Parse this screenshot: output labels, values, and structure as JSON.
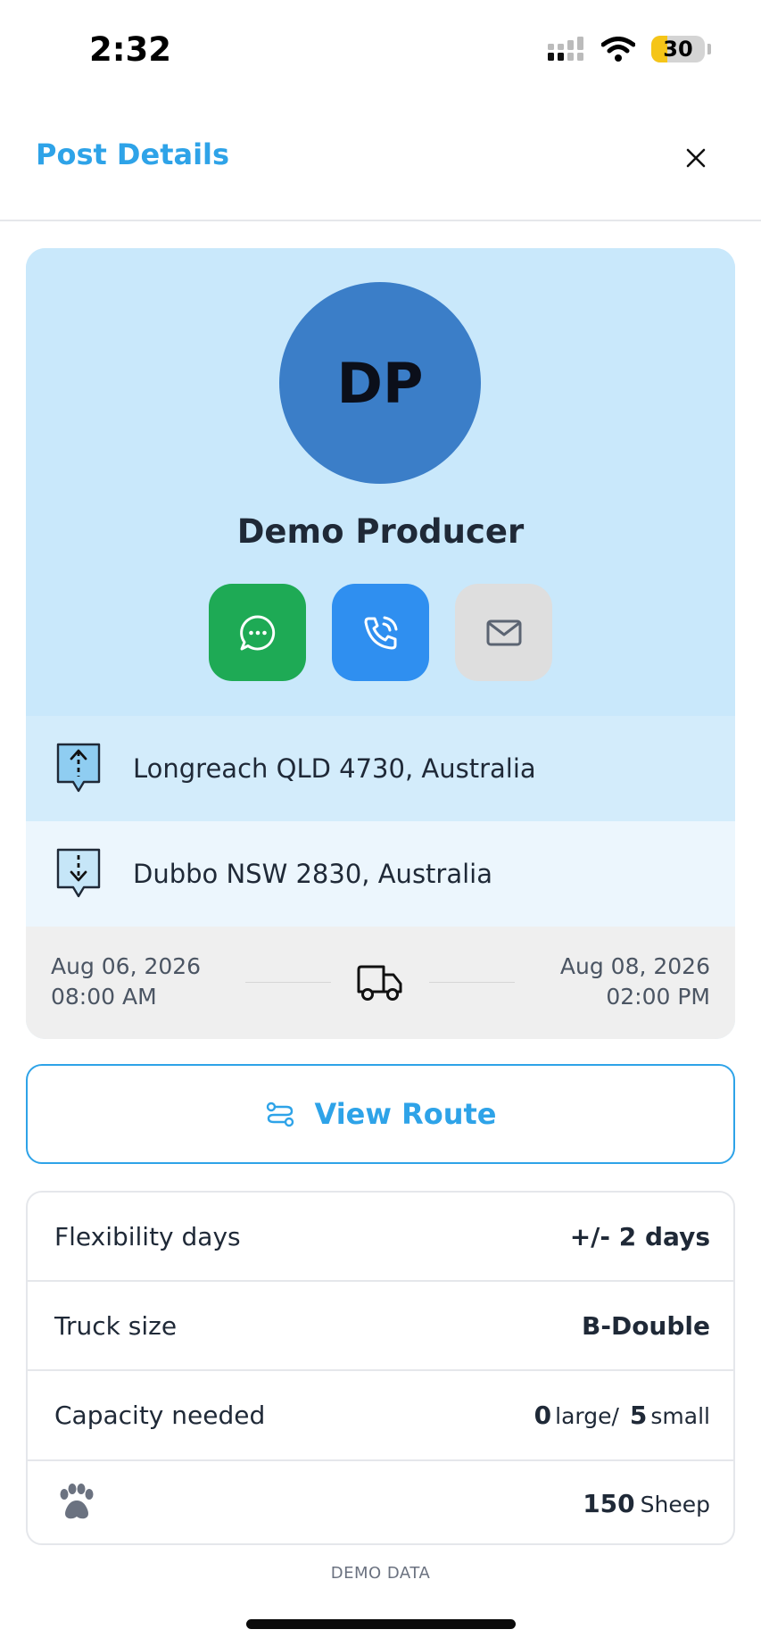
{
  "status_bar": {
    "time": "2:32",
    "battery_level": "30",
    "battery_fraction": 0.3
  },
  "header": {
    "title": "Post Details",
    "close_icon": "close-icon"
  },
  "profile": {
    "initials": "DP",
    "name": "Demo Producer",
    "actions": [
      {
        "icon": "whatsapp-chat-icon",
        "color": "#1eaa55"
      },
      {
        "icon": "phone-icon",
        "color": "#2f8ff0"
      },
      {
        "icon": "mail-icon",
        "color": "#dedede"
      }
    ]
  },
  "route": {
    "pickup": "Longreach QLD 4730, Australia",
    "dropoff": "Dubbo NSW 2830, Australia",
    "start_date": "Aug 06, 2026",
    "start_time": "08:00 AM",
    "end_date": "Aug 08, 2026",
    "end_time": "02:00 PM"
  },
  "view_route": {
    "label": "View Route"
  },
  "details": {
    "flexibility_label": "Flexibility days",
    "flexibility_value": "+/- 2 days",
    "truck_label": "Truck size",
    "truck_value": "B-Double",
    "capacity_label": "Capacity needed",
    "capacity_large_num": "0",
    "capacity_large_unit": "large/",
    "capacity_small_num": "5",
    "capacity_small_unit": "small",
    "livestock_num": "150",
    "livestock_type": "Sheep"
  },
  "footer": {
    "note": "DEMO DATA"
  },
  "colors": {
    "accent": "#2ea3e8",
    "avatar": "#3b7ec8",
    "card_bg": "#c9e8fb"
  }
}
